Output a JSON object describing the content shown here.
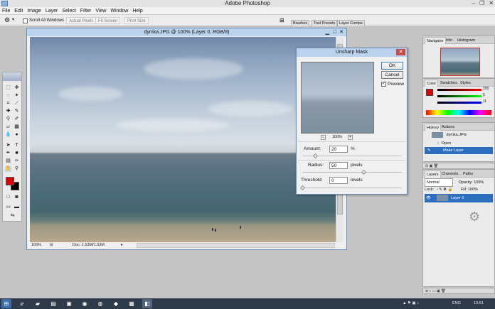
{
  "app": {
    "title": "Adobe Photoshop",
    "window_controls": [
      "–",
      "❐",
      "✕"
    ]
  },
  "menu": [
    "File",
    "Edit",
    "Image",
    "Layer",
    "Select",
    "Filter",
    "View",
    "Window",
    "Help"
  ],
  "options_bar": {
    "scroll_all_windows": "Scroll All Windows",
    "actual_pixels": "Actual Pixels",
    "fit_screen": "Fit Screen",
    "print_size": "Print Size",
    "well_tabs": [
      "Brushes",
      "Tool Presets",
      "Layer Comps"
    ]
  },
  "document": {
    "title": "dymka.JPG @ 100% (Layer 0, RGB/8)",
    "zoom": "100%",
    "doc_size": "Doc: 1.53M/1.53M"
  },
  "dialog": {
    "title": "Unsharp Mask",
    "ok": "OK",
    "cancel": "Cancel",
    "preview_label": "Preview",
    "preview_checked": true,
    "zoom_pct": "100%",
    "amount_label": "Amount:",
    "amount_value": "20",
    "amount_unit": "%",
    "radius_label": "Radius:",
    "radius_value": "50",
    "radius_unit": "pixels",
    "threshold_label": "Threshold:",
    "threshold_value": "0",
    "threshold_unit": "levels"
  },
  "panels": {
    "navigator_tabs": [
      "Navigator",
      "Info",
      "Histogram"
    ],
    "color_tabs": [
      "Color",
      "Swatches",
      "Styles"
    ],
    "color_values": {
      "r": "205",
      "g": "5",
      "b": "11"
    },
    "history_tabs": [
      "History",
      "Actions"
    ],
    "history_snapshot": "dymka.JPG",
    "history_items": [
      "Open",
      "Make Layer"
    ],
    "layers_tabs": [
      "Layers",
      "Channels",
      "Paths"
    ],
    "blend_mode": "Normal",
    "opacity_label": "Opacity:",
    "opacity_value": "100%",
    "lock_label": "Lock:",
    "fill_label": "Fill:",
    "fill_value": "100%",
    "layer_name": "Layer 0"
  },
  "taskbar": {
    "lang": "ENG",
    "time": "13:51"
  },
  "colors": {
    "foreground": "#e00000",
    "background": "#000000",
    "accent": "#2b6ec0"
  }
}
